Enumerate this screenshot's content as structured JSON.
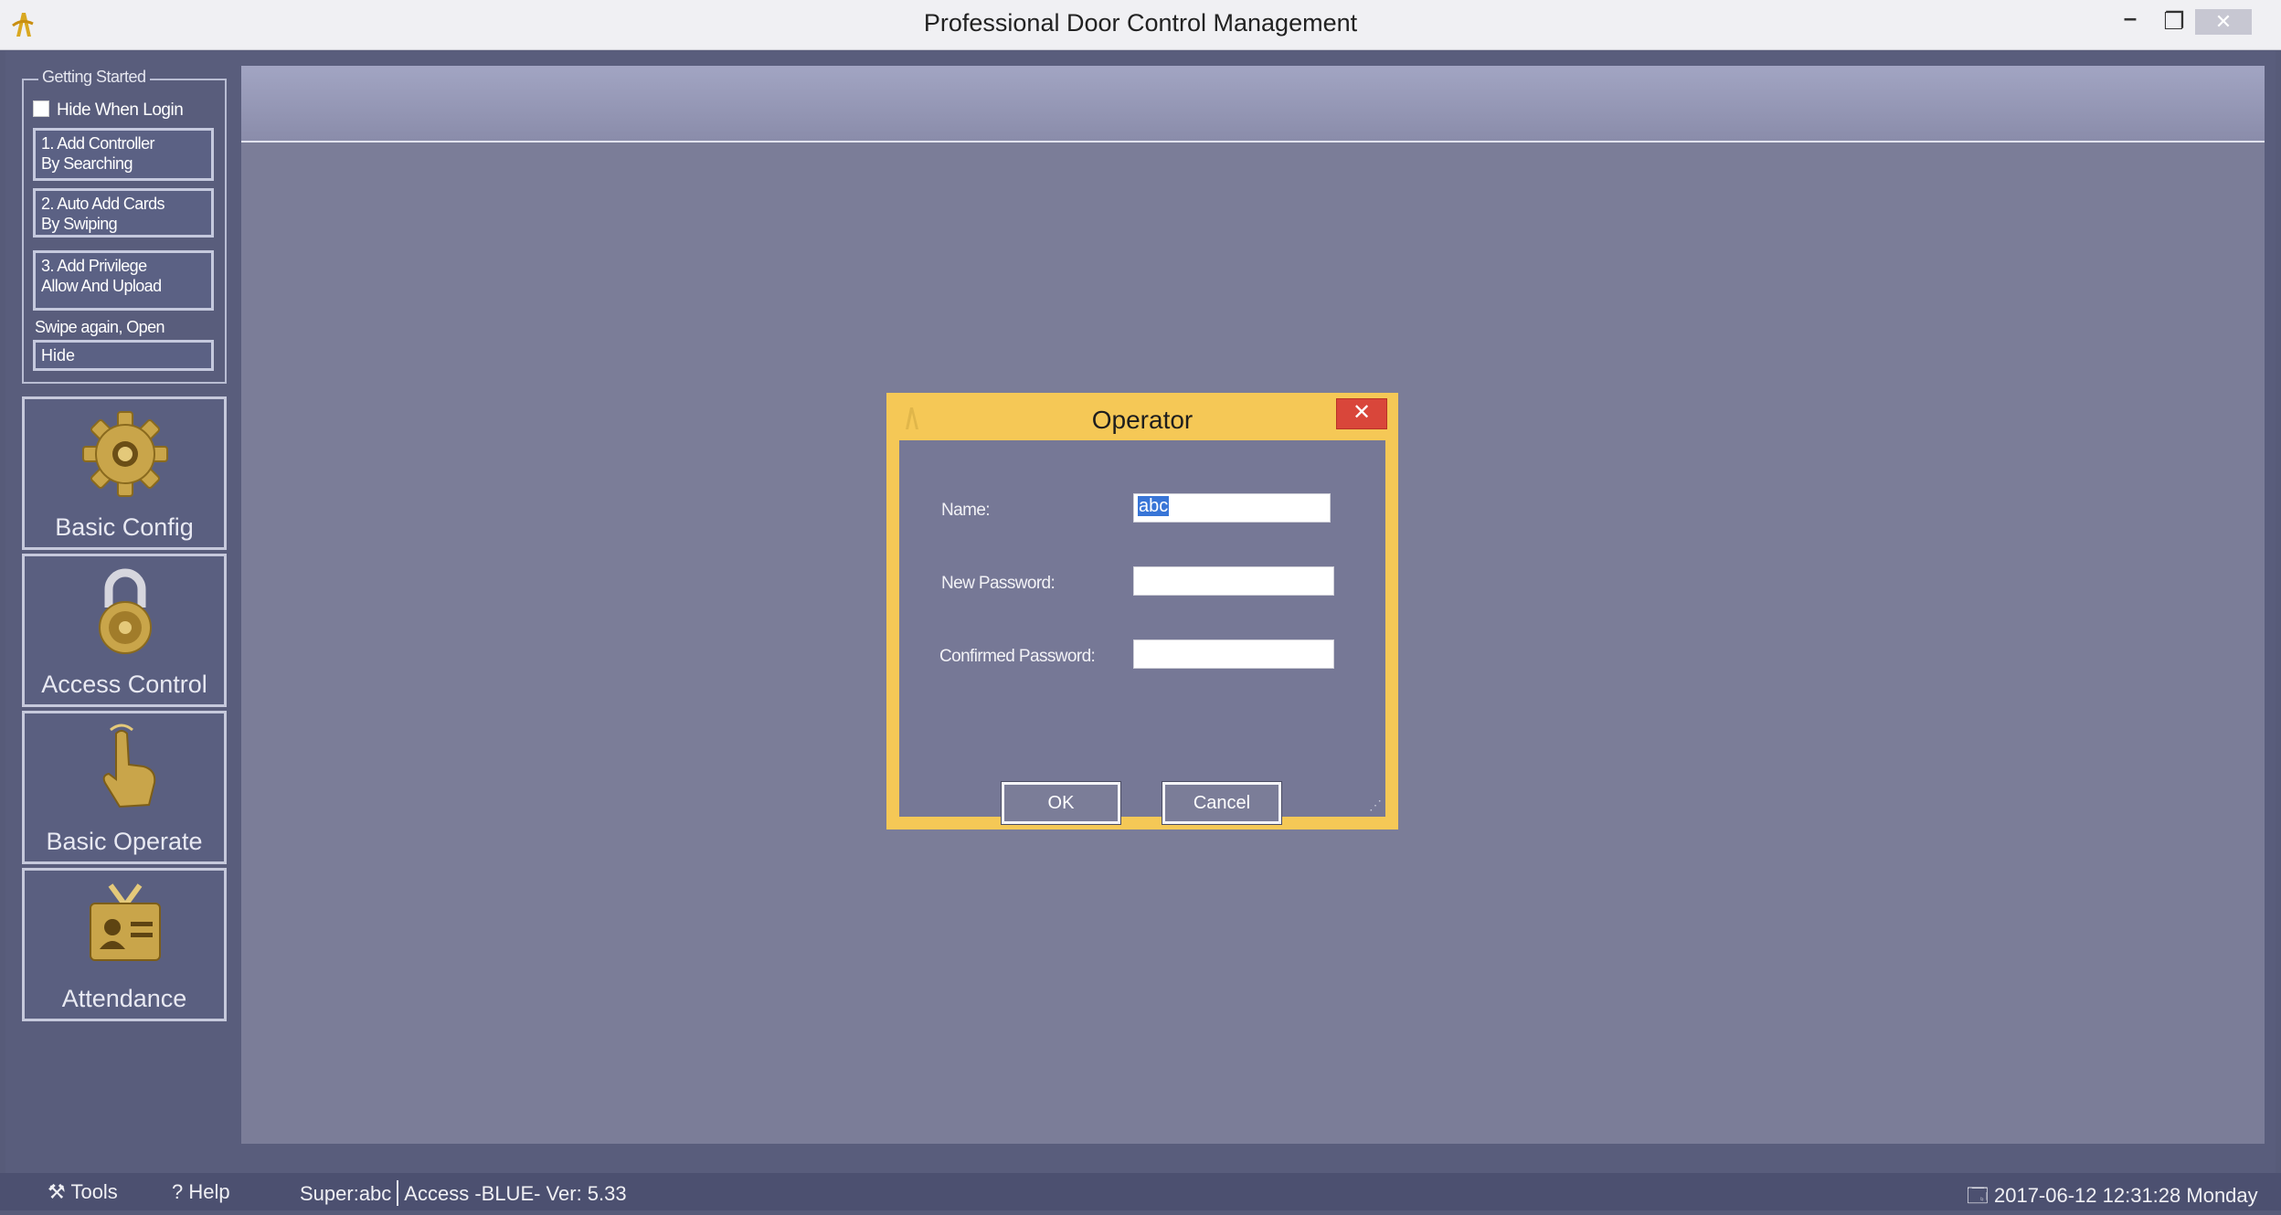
{
  "window": {
    "title": "Professional Door Control Management",
    "min_glyph": "–",
    "max_glyph": "❐",
    "close_glyph": "✕",
    "app_icon": "app-logo-icon"
  },
  "getting_started": {
    "legend": "Getting Started",
    "hide_when_login": "Hide When Login",
    "steps": [
      {
        "line1": "1. Add Controller",
        "line2": "By Searching"
      },
      {
        "line1": "2. Auto Add Cards",
        "line2": "By Swiping"
      },
      {
        "line1": "3. Add Privilege",
        "line2": "Allow And Upload"
      }
    ],
    "swipe_text": "Swipe again, Open",
    "hide_label": "Hide"
  },
  "nav": [
    {
      "label": "Basic Config",
      "icon": "gear-icon"
    },
    {
      "label": "Access Control",
      "icon": "padlock-icon"
    },
    {
      "label": "Basic Operate",
      "icon": "hand-pointer-icon"
    },
    {
      "label": "Attendance",
      "icon": "id-card-icon"
    }
  ],
  "dialog": {
    "title": "Operator",
    "close_glyph": "✕",
    "name_label": "Name:",
    "name_value": "abc",
    "new_password_label": "New Password:",
    "confirmed_password_label": "Confirmed Password:",
    "ok_label": "OK",
    "cancel_label": "Cancel"
  },
  "statusbar": {
    "tools_label": "Tools",
    "help_label": "Help",
    "user": "Super:abc",
    "version": "Access -BLUE- Ver: 5.33",
    "datetime": "2017-06-12 12:31:28 Monday"
  },
  "colors": {
    "dialog_frame": "#f5c856",
    "main_bg": "#7b7d98",
    "close_red": "#d9463a"
  }
}
